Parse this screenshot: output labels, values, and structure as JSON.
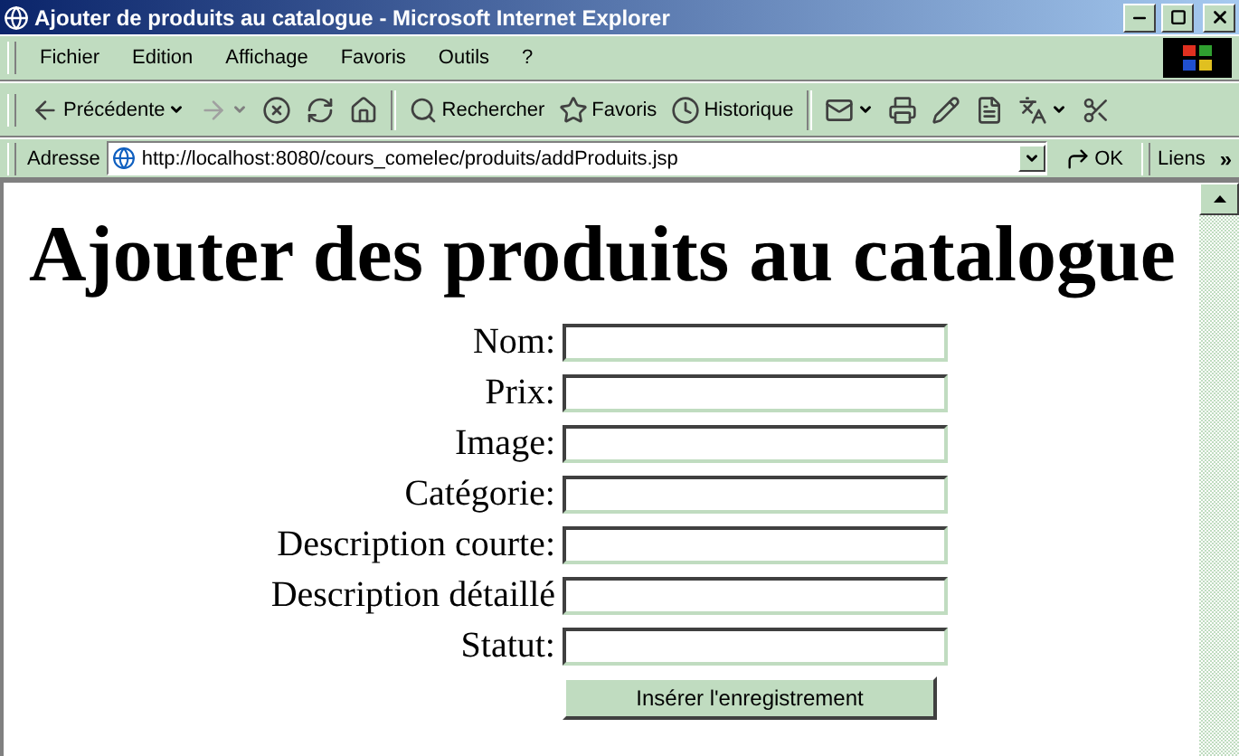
{
  "window": {
    "title": "Ajouter de produits au catalogue - Microsoft Internet Explorer"
  },
  "menu": {
    "items": [
      {
        "label": "Fichier"
      },
      {
        "label": "Edition"
      },
      {
        "label": "Affichage"
      },
      {
        "label": "Favoris"
      },
      {
        "label": "Outils"
      },
      {
        "label": "?"
      }
    ]
  },
  "toolbar": {
    "buttons": [
      {
        "kind": "back",
        "label": "Précédente",
        "caret": true,
        "disabled": false
      },
      {
        "kind": "forward",
        "caret": true,
        "disabled": true
      },
      {
        "kind": "stop",
        "caret": false,
        "disabled": false
      },
      {
        "kind": "refresh",
        "caret": false,
        "disabled": false
      },
      {
        "kind": "home",
        "caret": false,
        "disabled": false
      },
      {
        "kind": "separator"
      },
      {
        "kind": "search",
        "label": "Rechercher",
        "caret": false,
        "disabled": false
      },
      {
        "kind": "favorites",
        "label": "Favoris",
        "caret": false,
        "disabled": false
      },
      {
        "kind": "history",
        "label": "Historique",
        "caret": false,
        "disabled": false
      },
      {
        "kind": "separator"
      },
      {
        "kind": "mail",
        "caret": true,
        "disabled": false
      },
      {
        "kind": "print",
        "caret": false,
        "disabled": false
      },
      {
        "kind": "edit",
        "caret": false,
        "disabled": false
      },
      {
        "kind": "discuss",
        "caret": false,
        "disabled": false
      },
      {
        "kind": "translate",
        "caret": true,
        "disabled": false
      },
      {
        "kind": "cut",
        "caret": false,
        "disabled": false
      }
    ]
  },
  "address_bar": {
    "label": "Adresse",
    "url": "http://localhost:8080/cours_comelec/produits/addProduits.jsp",
    "go": "OK",
    "links": "Liens",
    "more": "»"
  },
  "page": {
    "heading": "Ajouter des produits au catalogue",
    "fields": [
      {
        "label": "Nom:"
      },
      {
        "label": "Prix:"
      },
      {
        "label": "Image:"
      },
      {
        "label": "Catégorie:"
      },
      {
        "label": "Description courte:"
      },
      {
        "label": "Description détaillé"
      },
      {
        "label": "Statut:"
      }
    ],
    "submit": "Insérer l'enregistrement"
  }
}
